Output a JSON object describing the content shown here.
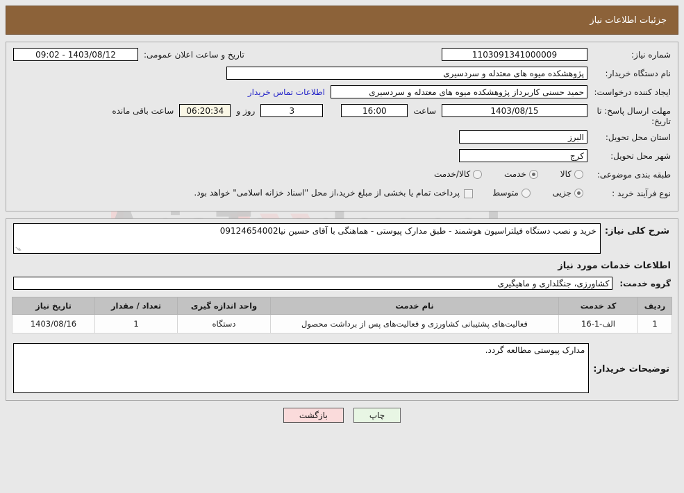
{
  "header": {
    "title": "جزئیات اطلاعات نیاز"
  },
  "form": {
    "need_number_label": "شماره نیاز:",
    "need_number_value": "1103091341000009",
    "public_announce_label": "تاریخ و ساعت اعلان عمومی:",
    "public_announce_value": "1403/08/12 - 09:02",
    "buyer_org_label": "نام دستگاه خریدار:",
    "buyer_org_value": "پژوهشکده میوه های معتدله و سردسیری",
    "requester_label": "ایجاد کننده درخواست:",
    "requester_value": "حمید حسنی کاربرداز  پژوهشکده میوه های معتدله و سردسیری",
    "contact_link": "اطلاعات تماس خریدار",
    "deadline_label": "مهلت ارسال پاسخ: تا تاریخ:",
    "deadline_date": "1403/08/15",
    "time_label": "ساعت",
    "deadline_time": "16:00",
    "days_value": "3",
    "days_label": "روز و",
    "countdown_value": "06:20:34",
    "remaining_label": "ساعت باقی مانده",
    "province_label": "استان محل تحویل:",
    "province_value": "البرز",
    "city_label": "شهر محل تحویل:",
    "city_value": "کرج",
    "category_label": "طبقه بندی موضوعی:",
    "category_options": [
      {
        "label": "کالا",
        "selected": false
      },
      {
        "label": "خدمت",
        "selected": true
      },
      {
        "label": "کالا/خدمت",
        "selected": false
      }
    ],
    "process_label": "نوع فرآیند خرید :",
    "process_options": [
      {
        "label": "جزیی",
        "selected": true
      },
      {
        "label": "متوسط",
        "selected": false
      }
    ],
    "treasury_checkbox_checked": false,
    "treasury_note": "پرداخت تمام یا بخشی از مبلغ خرید،از محل \"اسناد خزانه اسلامی\" خواهد بود."
  },
  "description": {
    "label": "شرح کلی نیاز:",
    "value": "خرید و نصب دستگاه فیلتراسیون هوشمند - طبق مدارک پیوستی - هماهنگی با آقای حسین نیا09124654002"
  },
  "services_section": {
    "heading": "اطلاعات خدمات مورد نیاز",
    "group_label": "گروه خدمت:",
    "group_value": "کشاورزی، جنگلداری و ماهیگیری"
  },
  "table": {
    "columns": [
      "ردیف",
      "کد خدمت",
      "نام خدمت",
      "واحد اندازه گیری",
      "تعداد / مقدار",
      "تاریخ نیاز"
    ],
    "rows": [
      {
        "row_no": "1",
        "service_code": "الف-1-16",
        "service_name": "فعالیت‌های پشتیبانی کشاورزی و فعالیت‌های پس از برداشت محصول",
        "unit": "دستگاه",
        "quantity": "1",
        "need_date": "1403/08/16"
      }
    ]
  },
  "buyer_notes": {
    "label": "توضیحات خریدار:",
    "value": "مدارک پیوستی مطالعه گردد."
  },
  "footer": {
    "print_label": "چاپ",
    "back_label": "بازگشت"
  },
  "watermark": {
    "text": "AriaTender.net"
  },
  "colors": {
    "header_bg": "#8c6239",
    "link": "#2323c8",
    "print_btn": "#e8f6e4",
    "back_btn": "#fadbdb",
    "countdown_bg": "#faf7e6",
    "table_header": "#c2c2c2"
  }
}
